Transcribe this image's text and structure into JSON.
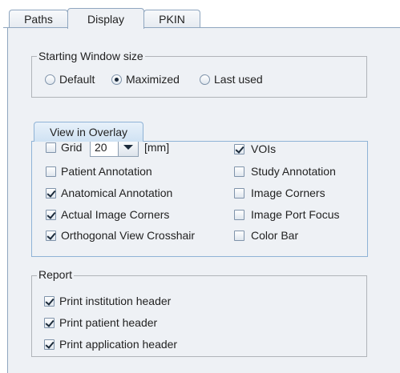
{
  "tabs": [
    {
      "label": "Paths"
    },
    {
      "label": "Display"
    },
    {
      "label": "PKIN"
    }
  ],
  "starting_window": {
    "title": "Starting Window size",
    "options": [
      {
        "label": "Default",
        "selected": false
      },
      {
        "label": "Maximized",
        "selected": true
      },
      {
        "label": "Last used",
        "selected": false
      }
    ]
  },
  "overlay": {
    "tab_label": "View in Overlay",
    "grid": {
      "label": "Grid",
      "checked": false,
      "value": "20",
      "unit": "[mm]"
    },
    "left_items": [
      {
        "label": "Patient Annotation",
        "checked": false
      },
      {
        "label": "Anatomical Annotation",
        "checked": true
      },
      {
        "label": "Actual Image Corners",
        "checked": true
      },
      {
        "label": "Orthogonal View Crosshair",
        "checked": true
      }
    ],
    "right_items": [
      {
        "label": "VOIs",
        "checked": true
      },
      {
        "label": "Study Annotation",
        "checked": false
      },
      {
        "label": "Image Corners",
        "checked": false
      },
      {
        "label": "Image Port Focus",
        "checked": false
      },
      {
        "label": "Color Bar",
        "checked": false
      }
    ]
  },
  "report": {
    "title": "Report",
    "items": [
      {
        "label": "Print institution header",
        "checked": true
      },
      {
        "label": "Print patient header",
        "checked": true
      },
      {
        "label": "Print application header",
        "checked": true
      }
    ]
  }
}
